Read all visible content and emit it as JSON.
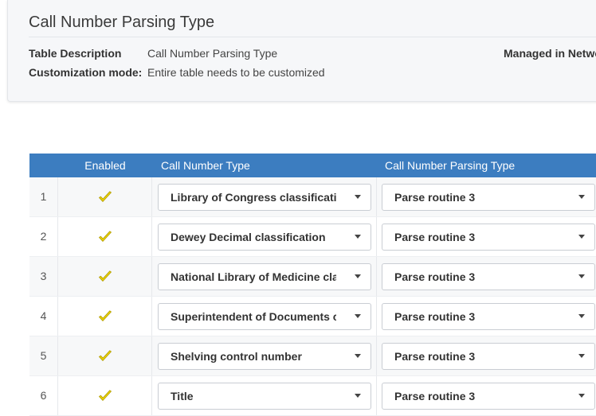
{
  "header": {
    "title": "Call Number Parsing Type",
    "table_description_label": "Table Description",
    "table_description_value": "Call Number Parsing Type",
    "customization_mode_label": "Customization mode:",
    "customization_mode_value": "Entire table needs to be customized",
    "managed_in_label": "Managed in Netwo"
  },
  "table": {
    "columns": {
      "enabled": "Enabled",
      "call_number_type": "Call Number Type",
      "call_number_parsing_type": "Call Number Parsing Type"
    },
    "rows": [
      {
        "num": "1",
        "enabled": true,
        "call_number_type": "Library of Congress classification",
        "parsing_type": "Parse routine 3"
      },
      {
        "num": "2",
        "enabled": true,
        "call_number_type": "Dewey Decimal classification",
        "parsing_type": "Parse routine 3"
      },
      {
        "num": "3",
        "enabled": true,
        "call_number_type": "National Library of Medicine classification",
        "parsing_type": "Parse routine 3"
      },
      {
        "num": "4",
        "enabled": true,
        "call_number_type": "Superintendent of Documents classification",
        "parsing_type": "Parse routine 3"
      },
      {
        "num": "5",
        "enabled": true,
        "call_number_type": "Shelving control number",
        "parsing_type": "Parse routine 3"
      },
      {
        "num": "6",
        "enabled": true,
        "call_number_type": "Title",
        "parsing_type": "Parse routine 3"
      }
    ]
  },
  "icons": {
    "enabled_check": "checkmark-icon",
    "dropdown": "caret-down-icon"
  },
  "colors": {
    "header_bar": "#3c7dc0",
    "checkmark": "#f0d800",
    "checkmark_outline": "#b09a00"
  }
}
